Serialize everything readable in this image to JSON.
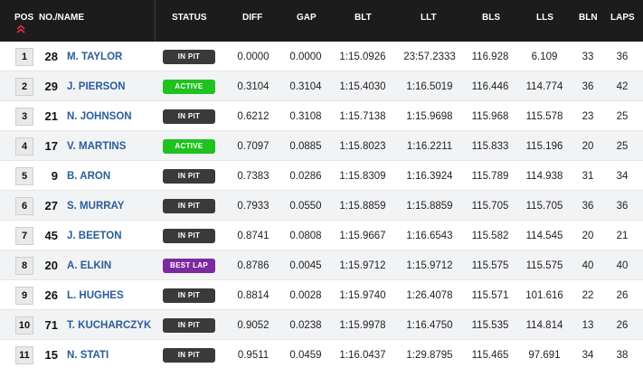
{
  "columns": {
    "pos": "POS",
    "name": "NO./NAME",
    "status": "STATUS",
    "diff": "DIFF",
    "gap": "GAP",
    "blt": "BLT",
    "llt": "LLT",
    "bls": "BLS",
    "lls": "LLS",
    "bln": "BLN",
    "laps": "LAPS"
  },
  "colors": {
    "header_bg": "#1c1c1c",
    "name_link": "#2a5d9a",
    "sort_icon": "#e0303a",
    "status_in_pit": "#3a3a3a",
    "status_active": "#1fc21f",
    "status_best_lap": "#7b2aa0"
  },
  "rows": [
    {
      "pos": "1",
      "no": "28",
      "name": "M. TAYLOR",
      "status": "IN PIT",
      "status_type": "in-pit",
      "diff": "0.0000",
      "gap": "0.0000",
      "blt": "1:15.0926",
      "llt": "23:57.2333",
      "bls": "116.928",
      "lls": "6.109",
      "bln": "33",
      "laps": "36"
    },
    {
      "pos": "2",
      "no": "29",
      "name": "J. PIERSON",
      "status": "ACTIVE",
      "status_type": "active",
      "diff": "0.3104",
      "gap": "0.3104",
      "blt": "1:15.4030",
      "llt": "1:16.5019",
      "bls": "116.446",
      "lls": "114.774",
      "bln": "36",
      "laps": "42"
    },
    {
      "pos": "3",
      "no": "21",
      "name": "N. JOHNSON",
      "status": "IN PIT",
      "status_type": "in-pit",
      "diff": "0.6212",
      "gap": "0.3108",
      "blt": "1:15.7138",
      "llt": "1:15.9698",
      "bls": "115.968",
      "lls": "115.578",
      "bln": "23",
      "laps": "25"
    },
    {
      "pos": "4",
      "no": "17",
      "name": "V. MARTINS",
      "status": "ACTIVE",
      "status_type": "active",
      "diff": "0.7097",
      "gap": "0.0885",
      "blt": "1:15.8023",
      "llt": "1:16.2211",
      "bls": "115.833",
      "lls": "115.196",
      "bln": "20",
      "laps": "25"
    },
    {
      "pos": "5",
      "no": "9",
      "name": "B. ARON",
      "status": "IN PIT",
      "status_type": "in-pit",
      "diff": "0.7383",
      "gap": "0.0286",
      "blt": "1:15.8309",
      "llt": "1:16.3924",
      "bls": "115.789",
      "lls": "114.938",
      "bln": "31",
      "laps": "34"
    },
    {
      "pos": "6",
      "no": "27",
      "name": "S. MURRAY",
      "status": "IN PIT",
      "status_type": "in-pit",
      "diff": "0.7933",
      "gap": "0.0550",
      "blt": "1:15.8859",
      "llt": "1:15.8859",
      "bls": "115.705",
      "lls": "115.705",
      "bln": "36",
      "laps": "36"
    },
    {
      "pos": "7",
      "no": "45",
      "name": "J. BEETON",
      "status": "IN PIT",
      "status_type": "in-pit",
      "diff": "0.8741",
      "gap": "0.0808",
      "blt": "1:15.9667",
      "llt": "1:16.6543",
      "bls": "115.582",
      "lls": "114.545",
      "bln": "20",
      "laps": "21"
    },
    {
      "pos": "8",
      "no": "20",
      "name": "A. ELKIN",
      "status": "BEST LAP",
      "status_type": "best-lap",
      "diff": "0.8786",
      "gap": "0.0045",
      "blt": "1:15.9712",
      "llt": "1:15.9712",
      "bls": "115.575",
      "lls": "115.575",
      "bln": "40",
      "laps": "40"
    },
    {
      "pos": "9",
      "no": "26",
      "name": "L. HUGHES",
      "status": "IN PIT",
      "status_type": "in-pit",
      "diff": "0.8814",
      "gap": "0.0028",
      "blt": "1:15.9740",
      "llt": "1:26.4078",
      "bls": "115.571",
      "lls": "101.616",
      "bln": "22",
      "laps": "26"
    },
    {
      "pos": "10",
      "no": "71",
      "name": "T. KUCHARCZYK",
      "status": "IN PIT",
      "status_type": "in-pit",
      "diff": "0.9052",
      "gap": "0.0238",
      "blt": "1:15.9978",
      "llt": "1:16.4750",
      "bls": "115.535",
      "lls": "114.814",
      "bln": "13",
      "laps": "26"
    },
    {
      "pos": "11",
      "no": "15",
      "name": "N. STATI",
      "status": "IN PIT",
      "status_type": "in-pit",
      "diff": "0.9511",
      "gap": "0.0459",
      "blt": "1:16.0437",
      "llt": "1:29.8795",
      "bls": "115.465",
      "lls": "97.691",
      "bln": "34",
      "laps": "38"
    }
  ]
}
